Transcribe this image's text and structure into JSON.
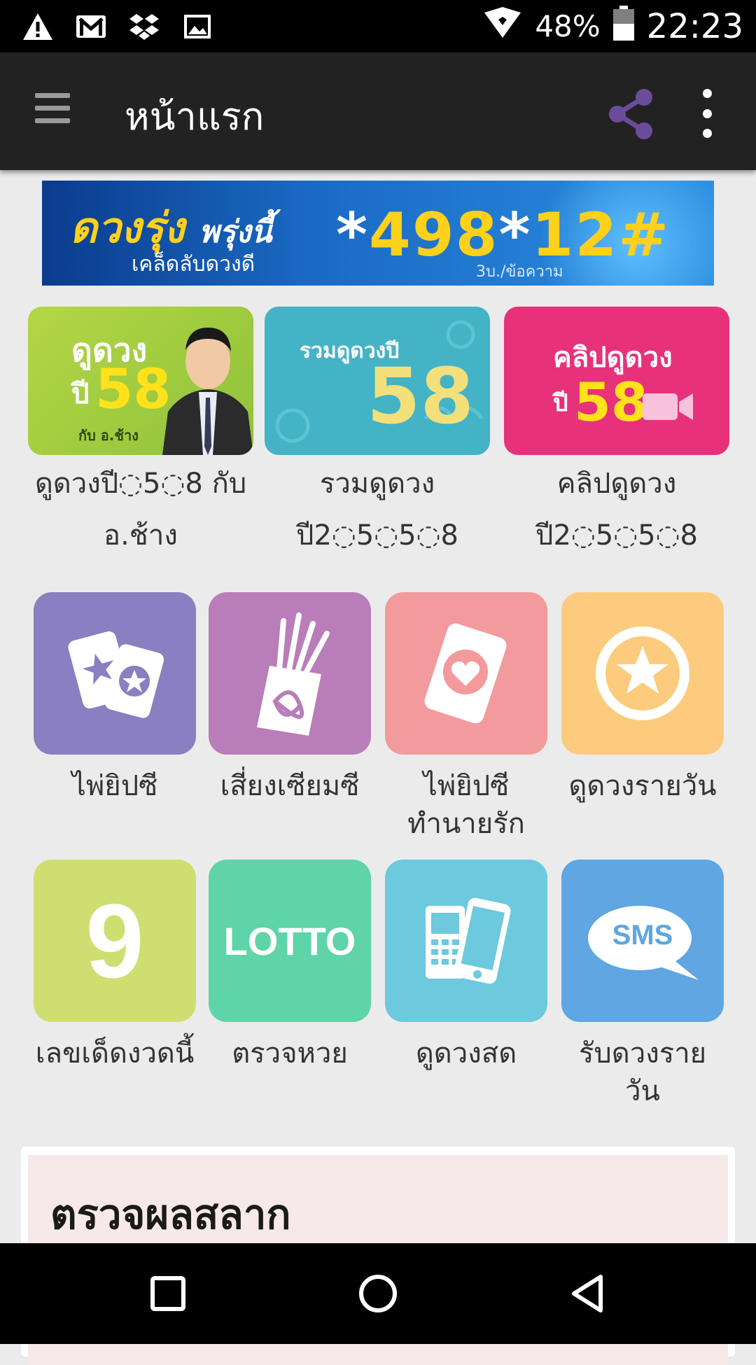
{
  "status_bar": {
    "battery": "48%",
    "time": "22:23",
    "icons": [
      "warning-icon",
      "gmail-icon",
      "dropbox-icon",
      "image-icon",
      "wifi-icon",
      "battery-icon"
    ]
  },
  "app_bar": {
    "title": "หน้าแรก",
    "icons": [
      "menu-icon",
      "share-icon",
      "more-vert-icon"
    ]
  },
  "banner": {
    "headline": "ดวงรุ่ง",
    "headline2": "พรุ่งนี้",
    "subtitle": "เคล็ดลับดวงดี",
    "code_star1": "*",
    "code_num1": "498",
    "code_star2": "*",
    "code_num2": "12#",
    "price": "3บ./ข้อความ"
  },
  "featured": [
    {
      "image_text": "ดูดวง",
      "image_year_prefix": "ปี",
      "image_year": "58",
      "image_caption": "กับ อ.ช้าง",
      "label_line1": "ดูดวงปี◌5◌8 กับ",
      "label_line2": "อ.ช้าง"
    },
    {
      "image_text": "รวมดูดวงปี",
      "image_year": "58",
      "label_line1": "รวมดูดวง",
      "label_line2": "ปี2◌5◌5◌8"
    },
    {
      "image_text": "คลิปดูดวง",
      "image_year_prefix": "ปี",
      "image_year": "58",
      "label_line1": "คลิปดูดวง",
      "label_line2": "ปี2◌5◌5◌8"
    }
  ],
  "tiles": [
    {
      "label_line1": "ไพ่ยิปซี",
      "label_line2": "",
      "color": "#8a7fc0",
      "icon": "tarot-cards-icon"
    },
    {
      "label_line1": "เสี่ยงเซียมซี",
      "label_line2": "",
      "color": "#b97db9",
      "icon": "fortune-sticks-icon"
    },
    {
      "label_line1": "ไพ่ยิปซี",
      "label_line2": "ทำนายรัก",
      "color": "#f39a9c",
      "icon": "love-card-icon"
    },
    {
      "label_line1": "ดูดวงรายวัน",
      "label_line2": "",
      "color": "#fccb7e",
      "icon": "star-icon"
    },
    {
      "label_line1": "เลขเด็ดงวดนี้",
      "label_line2": "",
      "color": "#cfde70",
      "icon": "number-nine-icon",
      "icon_text": "9"
    },
    {
      "label_line1": "ตรวจหวย",
      "label_line2": "",
      "color": "#5fd4a9",
      "icon": "lotto-icon",
      "icon_text": "LOTTO"
    },
    {
      "label_line1": "ดูดวงสด",
      "label_line2": "",
      "color": "#6cc9de",
      "icon": "phones-icon"
    },
    {
      "label_line1": "รับดวงราย",
      "label_line2": "วัน",
      "color": "#5fa6e2",
      "icon": "sms-icon",
      "icon_text": "SMS"
    }
  ],
  "lottery_card": {
    "title": "ตรวจผลสลาก"
  },
  "nav_bar": {
    "icons": [
      "recents-icon",
      "home-icon",
      "back-icon"
    ]
  }
}
